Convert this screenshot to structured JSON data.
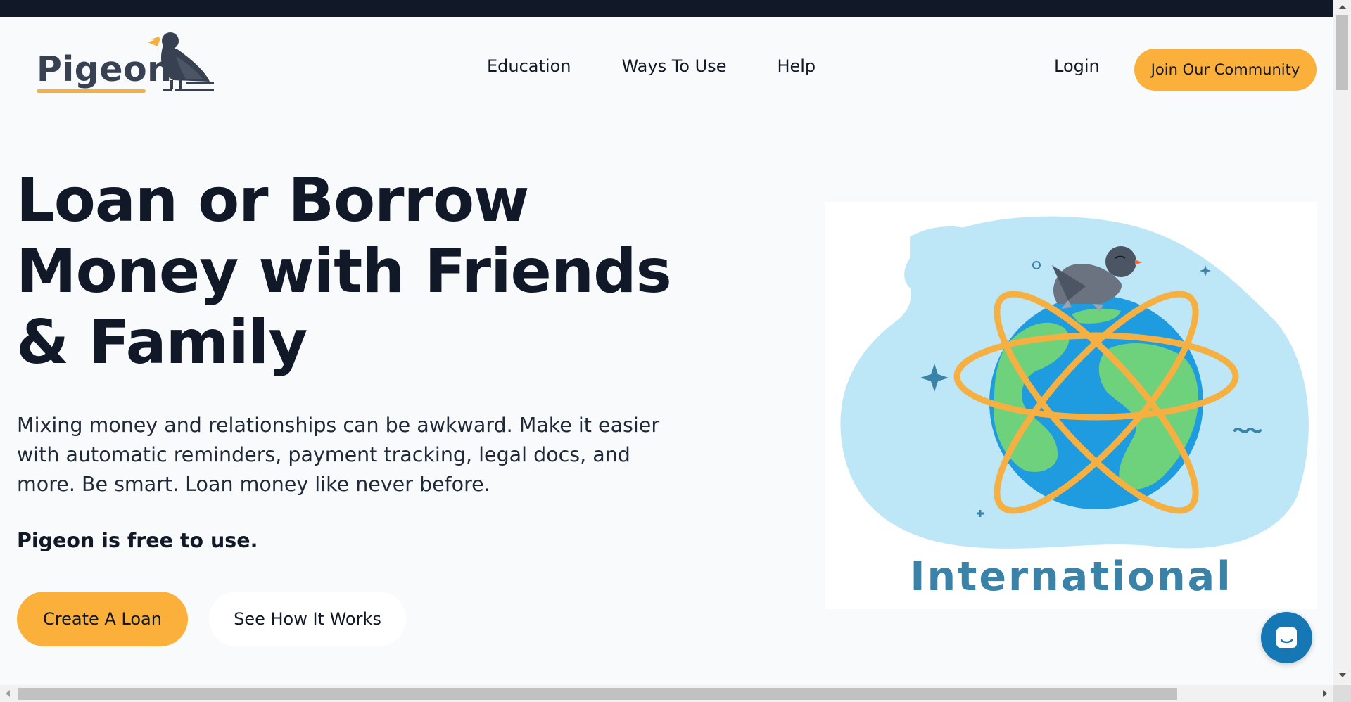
{
  "brand": {
    "name": "Pigeon",
    "accent_color": "#fbb03b",
    "dark_color": "#111827"
  },
  "nav": {
    "items": [
      {
        "label": "Education"
      },
      {
        "label": "Ways To Use"
      },
      {
        "label": "Help"
      }
    ],
    "login_label": "Login",
    "join_label": "Join Our Community"
  },
  "hero": {
    "title": "Loan or Borrow Money with Friends & Family",
    "description": "Mixing money and relationships can be awkward. Make it easier with automatic reminders, payment tracking, legal docs, and more. Be smart. Loan money like never before.",
    "free_note": "Pigeon is free to use.",
    "primary_cta": "Create A Loan",
    "secondary_cta": "See How It Works"
  },
  "illustration": {
    "label": "International",
    "icon": "globe-with-pigeon-illustration"
  },
  "chat": {
    "icon": "chat-bubble-icon"
  }
}
